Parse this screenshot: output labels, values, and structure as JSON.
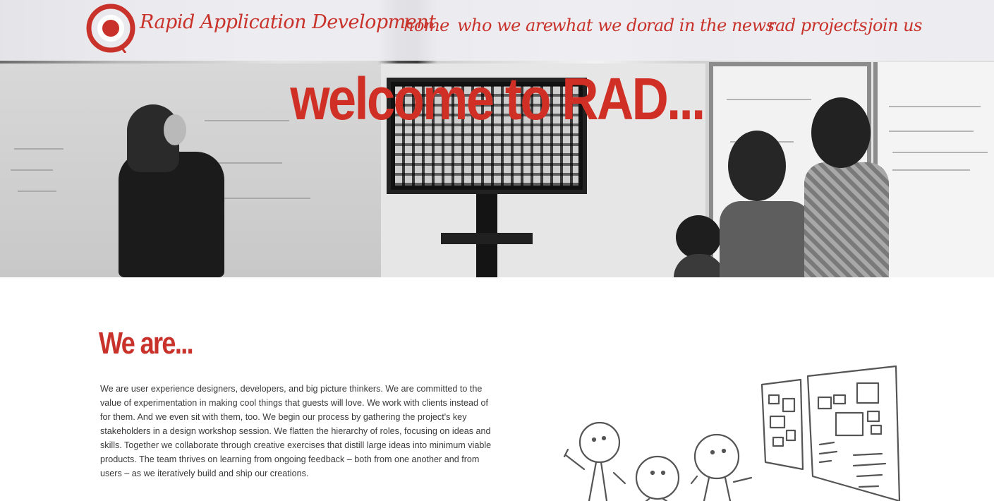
{
  "colors": {
    "accent": "#c8322a",
    "nav_bg": "#eeeef2",
    "body_text": "#3a3a3a"
  },
  "header": {
    "logo_icon": "target-icon",
    "brand": "Rapid Application Development"
  },
  "nav": {
    "items": [
      {
        "label": "home"
      },
      {
        "label": "who we are"
      },
      {
        "label": "what we do"
      },
      {
        "label": "rad in the news"
      },
      {
        "label": "rad projects"
      },
      {
        "label": "join us"
      }
    ]
  },
  "hero": {
    "title": "welcome to RAD..."
  },
  "about": {
    "heading": "We are...",
    "body": "We are user experience designers, developers, and big picture thinkers. We are committed to the value of experimentation in making cool things that guests will love. We work with clients instead of for them. And we even sit with them, too. We begin our process by gathering the project's key stakeholders in a design workshop session. We flatten the hierarchy of roles, focusing on ideas and skills. Together we collaborate through creative exercises that distill large ideas into minimum viable products. The team thrives on learning from ongoing feedback – both from one another and from users – as we iteratively build and ship our creations.",
    "illustration": "team-at-whiteboard-sketch"
  }
}
